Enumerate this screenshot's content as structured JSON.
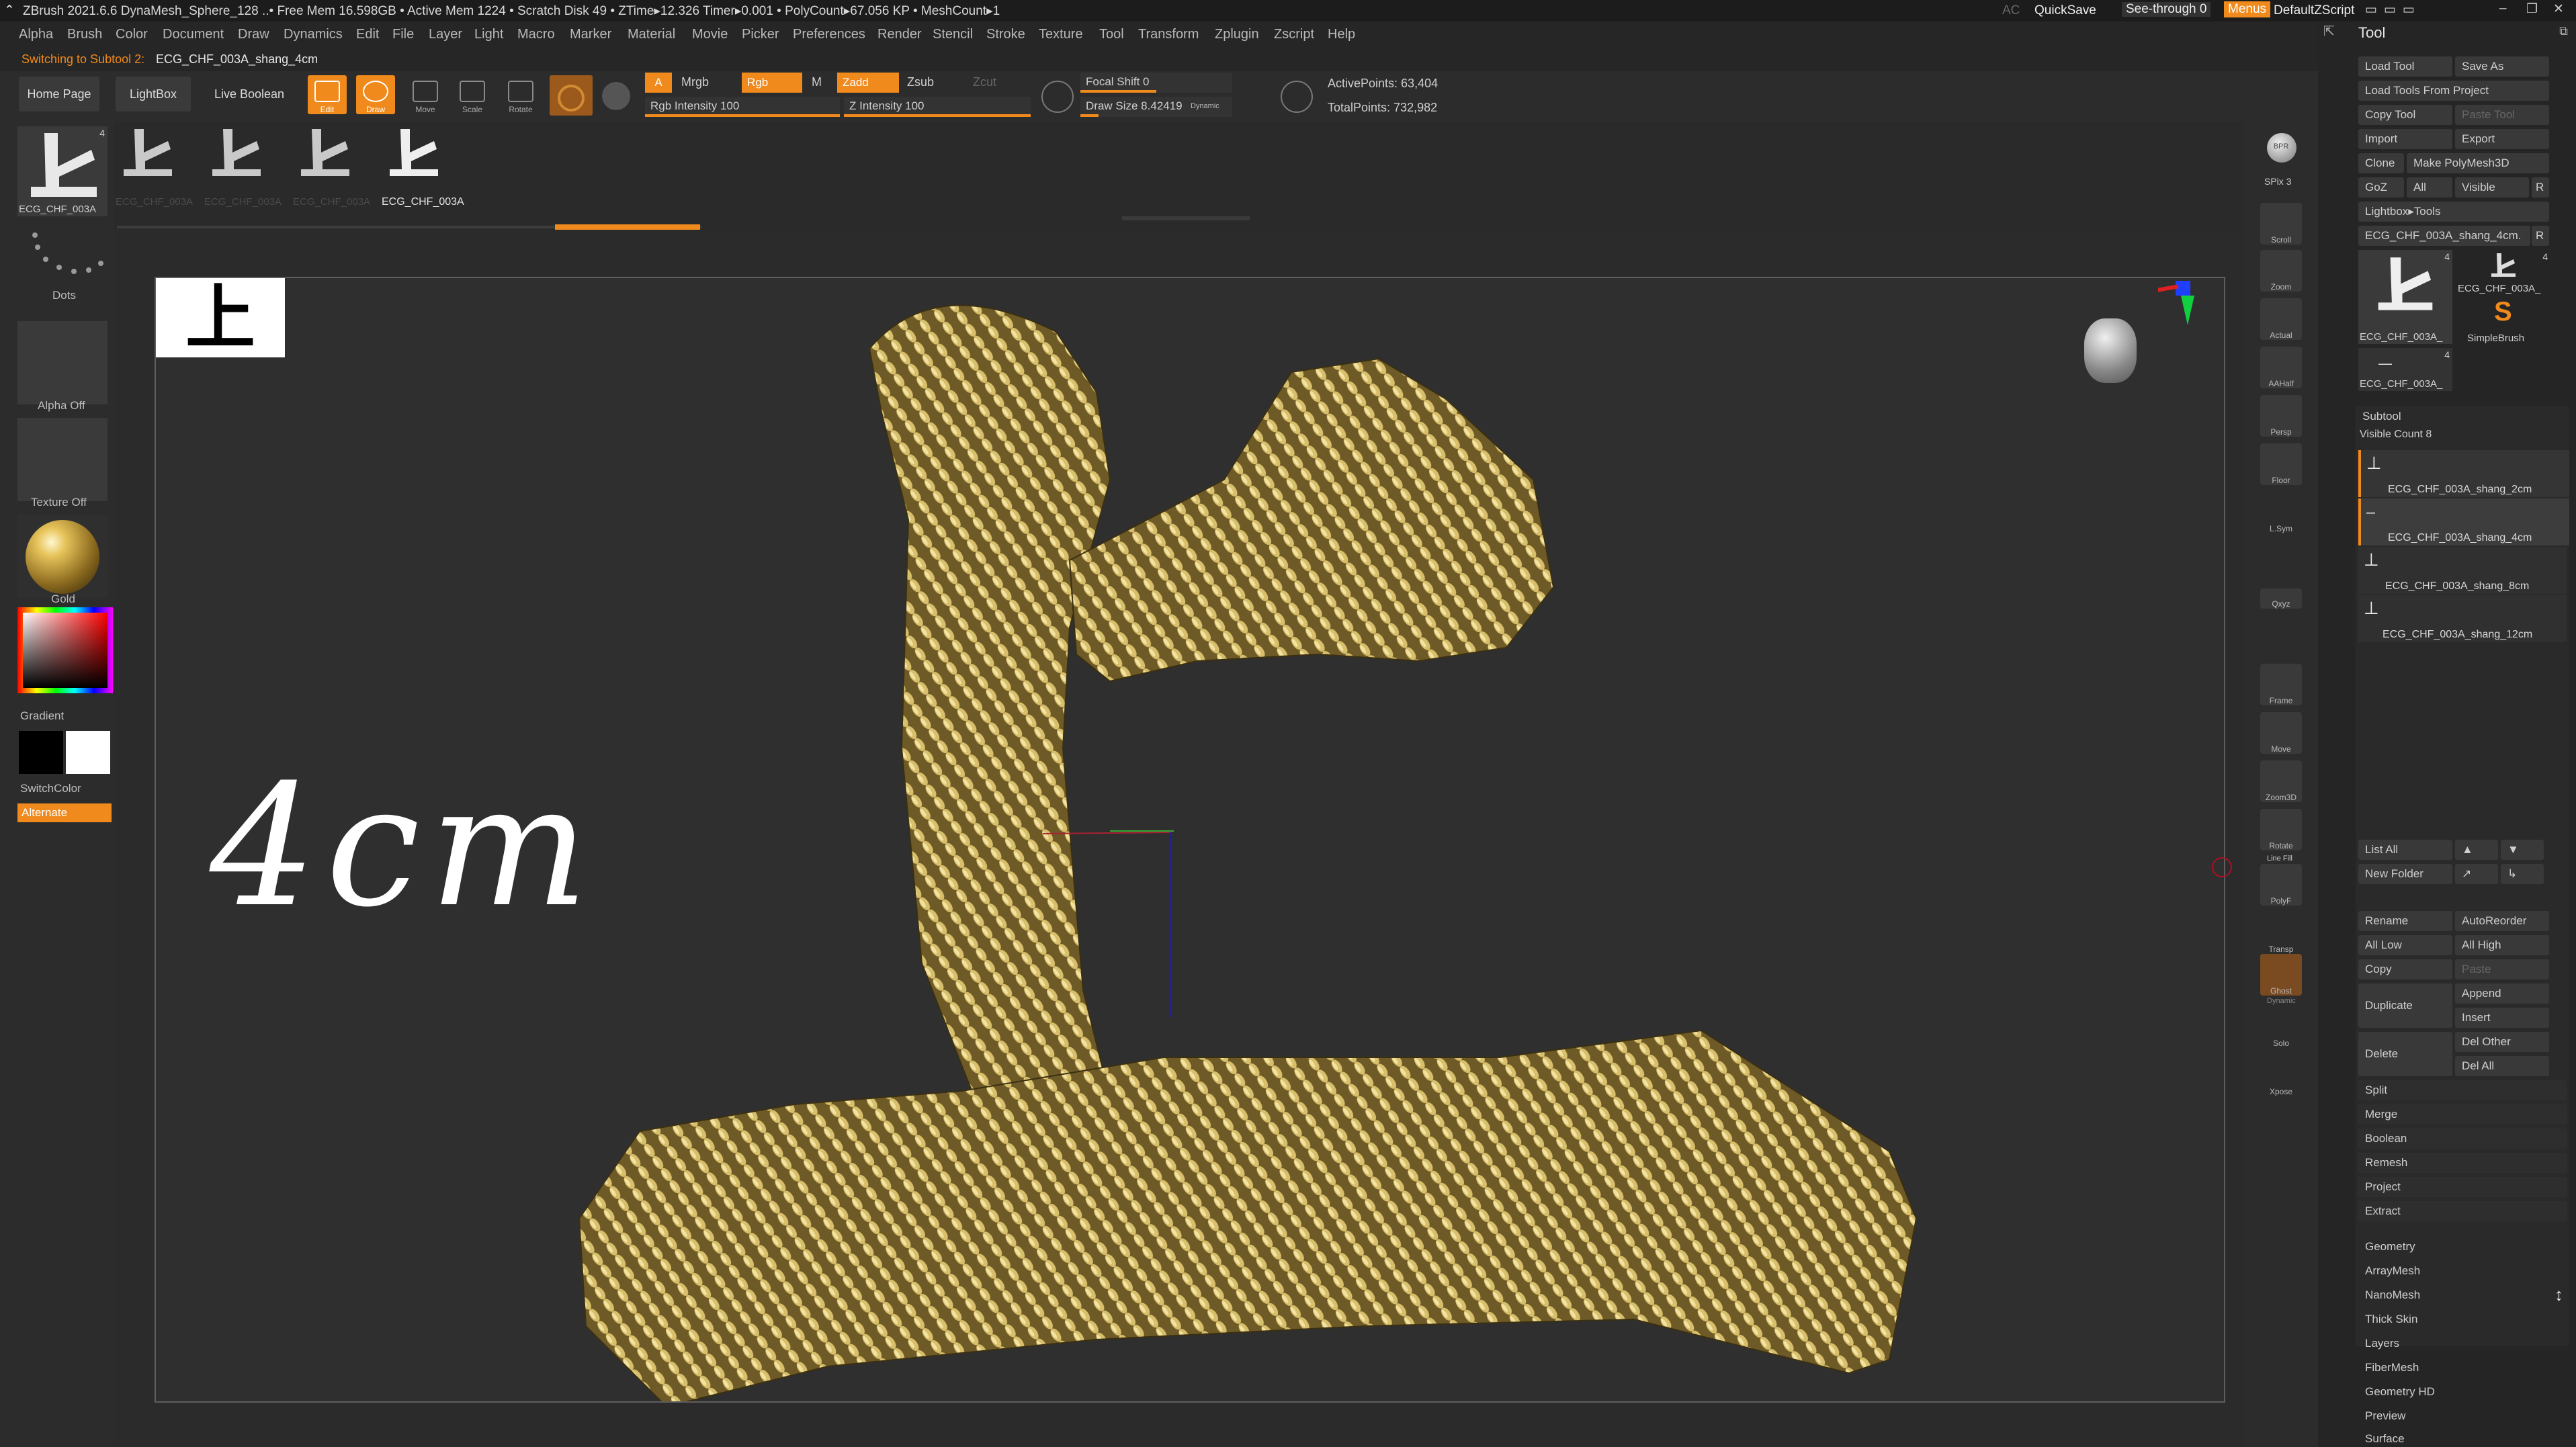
{
  "title_bar": {
    "text": "ZBrush 2021.6.6    DynaMesh_Sphere_128    ..• Free Mem 16.598GB • Active Mem 1224 • Scratch Disk 49 • ZTime▸12.326 Timer▸0.001 • PolyCount▸67.056 KP • MeshCount▸1",
    "ac": "AC",
    "quicksave": "QuickSave",
    "seethrough": "See-through  0",
    "menus": "Menus",
    "default_zscript": "DefaultZScript"
  },
  "menu": [
    "Alpha",
    "Brush",
    "Color",
    "Document",
    "Draw",
    "Dynamics",
    "Edit",
    "File",
    "Layer",
    "Light",
    "Macro",
    "Marker",
    "Material",
    "Movie",
    "Picker",
    "Preferences",
    "Render",
    "Stencil",
    "Stroke",
    "Texture",
    "Tool",
    "Transform",
    "Zplugin",
    "Zscript",
    "Help"
  ],
  "status": {
    "prefix": "Switching to Subtool 2:",
    "name": "ECG_CHF_003A_shang_4cm"
  },
  "toolbar": {
    "home_page": "Home Page",
    "lightbox": "LightBox",
    "live_boolean": "Live Boolean",
    "edit": "Edit",
    "draw": "Draw",
    "move": "Move",
    "scale": "Scale",
    "rotate": "Rotate",
    "a": "A",
    "mrgb": "Mrgb",
    "rgb": "Rgb",
    "m": "M",
    "zadd": "Zadd",
    "zsub": "Zsub",
    "zcut": "Zcut",
    "rgb_intensity": "Rgb Intensity 100",
    "z_intensity": "Z Intensity 100",
    "focal_shift": "Focal Shift 0",
    "draw_size": "Draw Size 8.42419",
    "dynamic": "Dynamic",
    "active_points": "ActivePoints: 63,404",
    "total_points": "TotalPoints: 732,982"
  },
  "thumbs": [
    "ECG_CHF_003A",
    "ECG_CHF_003A",
    "ECG_CHF_003A",
    "ECG_CHF_003A"
  ],
  "left_shelf": {
    "tool_name": "ECG_CHF_003A",
    "tool_count": "4",
    "dots": "Dots",
    "alpha": "Alpha Off",
    "texture": "Texture Off",
    "material": "Gold",
    "gradient": "Gradient",
    "switchcolor": "SwitchColor",
    "alternate": "Alternate"
  },
  "canvas": {
    "stamp_glyph": "上",
    "overlay_text": "4cm"
  },
  "right_shelf": [
    "SPix 3",
    "Scroll",
    "Zoom",
    "Actual",
    "AAHalf",
    "Persp",
    "Floor",
    "L.Sym",
    "",
    "Qxyz",
    "",
    "",
    "Frame",
    "Move",
    "Zoom3D",
    "Rotate",
    "PolyF",
    "Transp",
    "Ghost",
    "Solo",
    "Xpose"
  ],
  "right_shelf_extra": {
    "bpr": "BPR",
    "line_fill": "Line Fill",
    "dynamic": "Dynamic"
  },
  "tool_panel": {
    "title": "Tool",
    "load_tool": "Load Tool",
    "save_as": "Save As",
    "load_from_project": "Load Tools From Project",
    "copy_tool": "Copy Tool",
    "paste_tool": "Paste Tool",
    "import": "Import",
    "export": "Export",
    "clone": "Clone",
    "make_polymesh": "Make PolyMesh3D",
    "goz": "GoZ",
    "all": "All",
    "visible": "Visible",
    "r": "R",
    "lightbox_tools": "Lightbox▸Tools",
    "current_tool": "ECG_CHF_003A_shang_4cm.",
    "current_r": "R",
    "tool_thumbs": [
      {
        "label": "ECG_CHF_003A_",
        "count": "4"
      },
      {
        "label": "ECG_CHF_003A_",
        "count": "4"
      },
      {
        "label": "SimpleBrush",
        "count": ""
      },
      {
        "label": "ECG_CHF_003A_",
        "count": "4"
      }
    ]
  },
  "subtool": {
    "title": "Subtool",
    "visible_count": "Visible Count 8",
    "items": [
      "ECG_CHF_003A_shang_2cm",
      "ECG_CHF_003A_shang_4cm",
      "ECG_CHF_003A_shang_8cm",
      "ECG_CHF_003A_shang_12cm"
    ],
    "list_all": "List All",
    "new_folder": "New Folder",
    "rename": "Rename",
    "autoreorder": "AutoReorder",
    "all_low": "All Low",
    "all_high": "All High",
    "copy": "Copy",
    "paste": "Paste",
    "duplicate": "Duplicate",
    "append": "Append",
    "insert": "Insert",
    "delete": "Delete",
    "del_other": "Del Other",
    "del_all": "Del All",
    "split": "Split",
    "merge": "Merge",
    "boolean": "Boolean",
    "remesh": "Remesh",
    "project": "Project",
    "extract": "Extract"
  },
  "sections": [
    "Geometry",
    "ArrayMesh",
    "NanoMesh",
    "Thick Skin",
    "Layers",
    "FiberMesh",
    "Geometry HD",
    "Preview",
    "Surface"
  ],
  "colors": {
    "accent": "#f08a1c",
    "gold": "#c7ad5a",
    "panel": "#252525"
  }
}
